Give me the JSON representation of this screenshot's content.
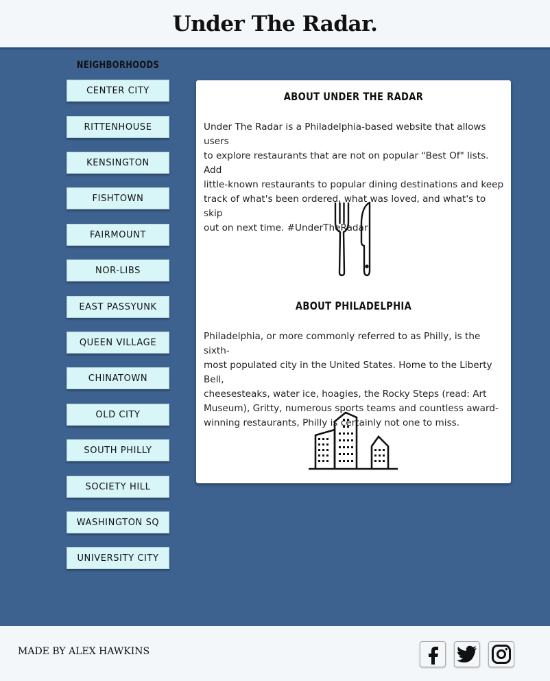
{
  "header": {
    "title": "Under The Radar."
  },
  "sidebar": {
    "heading": "NEIGHBORHOODS",
    "items": [
      {
        "label": "CENTER CITY"
      },
      {
        "label": "RITTENHOUSE"
      },
      {
        "label": "KENSINGTON"
      },
      {
        "label": "FISHTOWN"
      },
      {
        "label": "FAIRMOUNT"
      },
      {
        "label": "NOR-LIBS"
      },
      {
        "label": "EAST PASSYUNK"
      },
      {
        "label": "QUEEN VILLAGE"
      },
      {
        "label": "CHINATOWN"
      },
      {
        "label": "OLD CITY"
      },
      {
        "label": "SOUTH PHILLY"
      },
      {
        "label": "SOCIETY HILL"
      },
      {
        "label": "WASHINGTON SQ"
      },
      {
        "label": "UNIVERSITY CITY"
      }
    ]
  },
  "main": {
    "about_site": {
      "heading": "ABOUT UNDER THE RADAR",
      "lines": [
        "Under The Radar is a Philadelphia-based website that allows users",
        "to explore restaurants that are not on popular \"Best Of\" lists. Add",
        "little-known restaurants to popular dining destinations and keep",
        "track of what's been ordered, what was loved, and what's to skip",
        "out on next time. #UnderTheRadar"
      ],
      "icon": "fork-knife-icon"
    },
    "about_city": {
      "heading": "ABOUT PHILADELPHIA",
      "lines": [
        "Philadelphia, or more commonly referred to as Philly, is the sixth-",
        "most populated city in the United States. Home to the Liberty Bell,",
        "cheesesteaks, water ice, hoagies, the Rocky Steps (read: Art",
        "Museum), Gritty, numerous sports teams and countless award-",
        "winning restaurants, Philly is certainly not one to miss."
      ],
      "icon": "city-skyline-icon"
    }
  },
  "footer": {
    "credit": "MADE BY ALEX HAWKINS",
    "social": [
      "facebook-icon",
      "twitter-icon",
      "instagram-icon"
    ]
  },
  "colors": {
    "background": "#3d6290",
    "header_bg": "#f4f7f9",
    "button_bg": "#d8f5f7",
    "card_bg": "#ffffff"
  }
}
